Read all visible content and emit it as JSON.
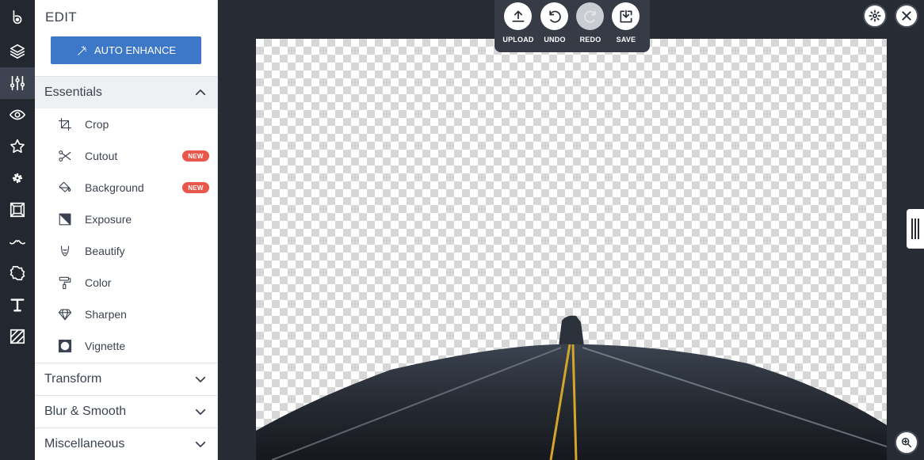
{
  "panel": {
    "title": "EDIT",
    "auto_enhance": "AUTO ENHANCE",
    "sections": {
      "essentials": "Essentials",
      "transform": "Transform",
      "blur_smooth": "Blur & Smooth",
      "miscellaneous": "Miscellaneous"
    },
    "tools": [
      {
        "label": "Crop",
        "icon": "crop-icon"
      },
      {
        "label": "Cutout",
        "icon": "scissors-icon",
        "badge": "NEW"
      },
      {
        "label": "Background",
        "icon": "paint-bucket-icon",
        "badge": "NEW"
      },
      {
        "label": "Exposure",
        "icon": "exposure-icon"
      },
      {
        "label": "Beautify",
        "icon": "beautify-icon"
      },
      {
        "label": "Color",
        "icon": "paint-roller-icon"
      },
      {
        "label": "Sharpen",
        "icon": "diamond-icon"
      },
      {
        "label": "Vignette",
        "icon": "vignette-icon"
      }
    ]
  },
  "toolbar": {
    "upload": "UPLOAD",
    "undo": "UNDO",
    "redo": "REDO",
    "save": "SAVE"
  },
  "rail_icons": [
    "logo-icon",
    "layers-icon",
    "sliders-icon",
    "eye-icon",
    "star-icon",
    "flower-icon",
    "frame-icon",
    "mustache-icon",
    "badge-icon",
    "text-icon",
    "texture-icon"
  ],
  "colors": {
    "accent": "#3d78c8",
    "badge": "#e7574b",
    "rail": "#232730",
    "workspace": "#272b34"
  }
}
